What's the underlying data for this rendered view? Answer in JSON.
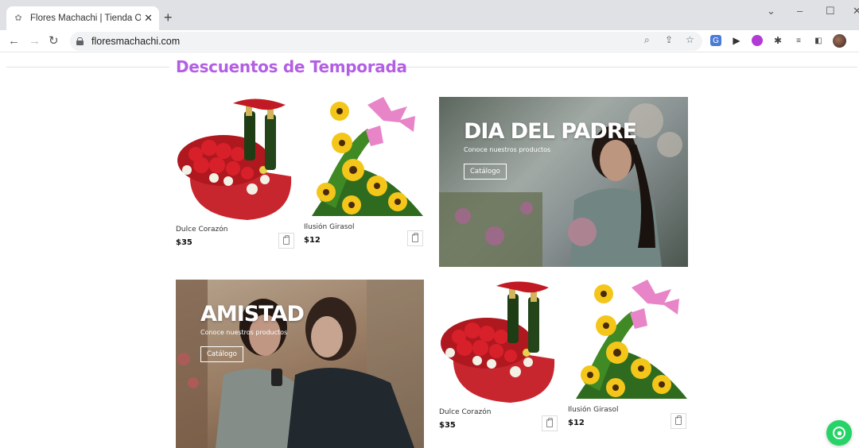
{
  "browser": {
    "tab_title": "Flores Machachi | Tienda Online",
    "tab_close": "✕",
    "new_tab": "+",
    "address": "floresmachachi.com"
  },
  "section": {
    "heading": "Descuentos de Temporada"
  },
  "products": [
    {
      "name": "Dulce Corazón",
      "price": "$35"
    },
    {
      "name": "Ilusión Girasol",
      "price": "$12"
    },
    {
      "name": "Dulce Corazón",
      "price": "$35"
    },
    {
      "name": "Ilusión Girasol",
      "price": "$12"
    }
  ],
  "banners": {
    "dad": {
      "title": "DIA DEL PADRE",
      "subtitle": "Conoce nuestros productos",
      "button": "Catálogo"
    },
    "friendship": {
      "title": "AMISTAD",
      "subtitle": "Conoce nuestros productos",
      "button": "Catálogo"
    }
  },
  "colors": {
    "accent": "#b35fe4",
    "whatsapp": "#25d366"
  }
}
